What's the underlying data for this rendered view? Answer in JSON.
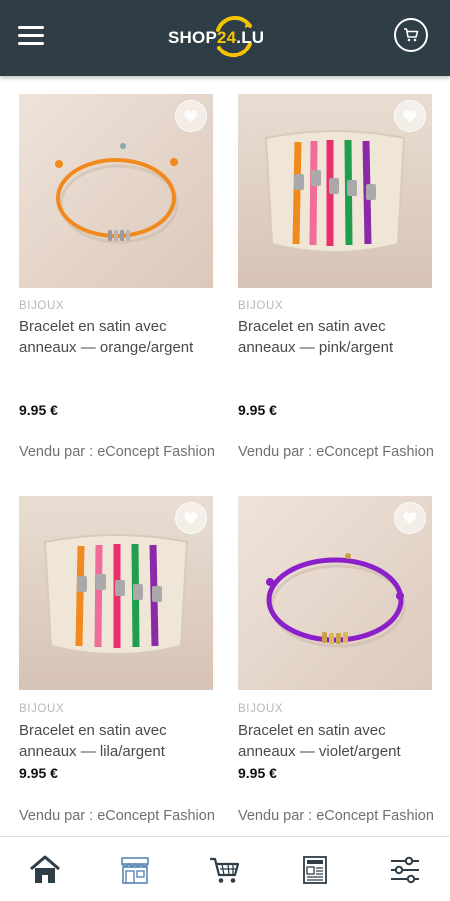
{
  "header": {
    "logo_prefix": "SHOP",
    "logo_number": "24",
    "logo_suffix": ".LU",
    "icons": [
      "menu-icon",
      "cart-icon"
    ]
  },
  "products": [
    {
      "category": "BIJOUX",
      "title": "Bracelet en satin avec anneaux — orange/argent",
      "price": "9.95 €",
      "seller": "Vendu par : eConcept Fashion"
    },
    {
      "category": "BIJOUX",
      "title": "Bracelet en satin avec anneaux — pink/argent",
      "price": "9.95 €",
      "seller": "Vendu par : eConcept Fashion"
    },
    {
      "category": "BIJOUX",
      "title": "Bracelet en satin avec anneaux — lila/argent",
      "price": "9.95 €",
      "seller": "Vendu par : eConcept Fashion"
    },
    {
      "category": "BIJOUX",
      "title": "Bracelet en satin avec anneaux — violet/argent",
      "price": "9.95 €",
      "seller": "Vendu par : eConcept Fashion"
    }
  ],
  "bottom_nav": [
    "home-icon",
    "store-icon",
    "cart-icon",
    "news-icon",
    "filter-icon"
  ],
  "colors": {
    "header_bg": "#2f3d47",
    "logo_accent": "#f5c400",
    "nav_icon": "#2f3d47"
  }
}
